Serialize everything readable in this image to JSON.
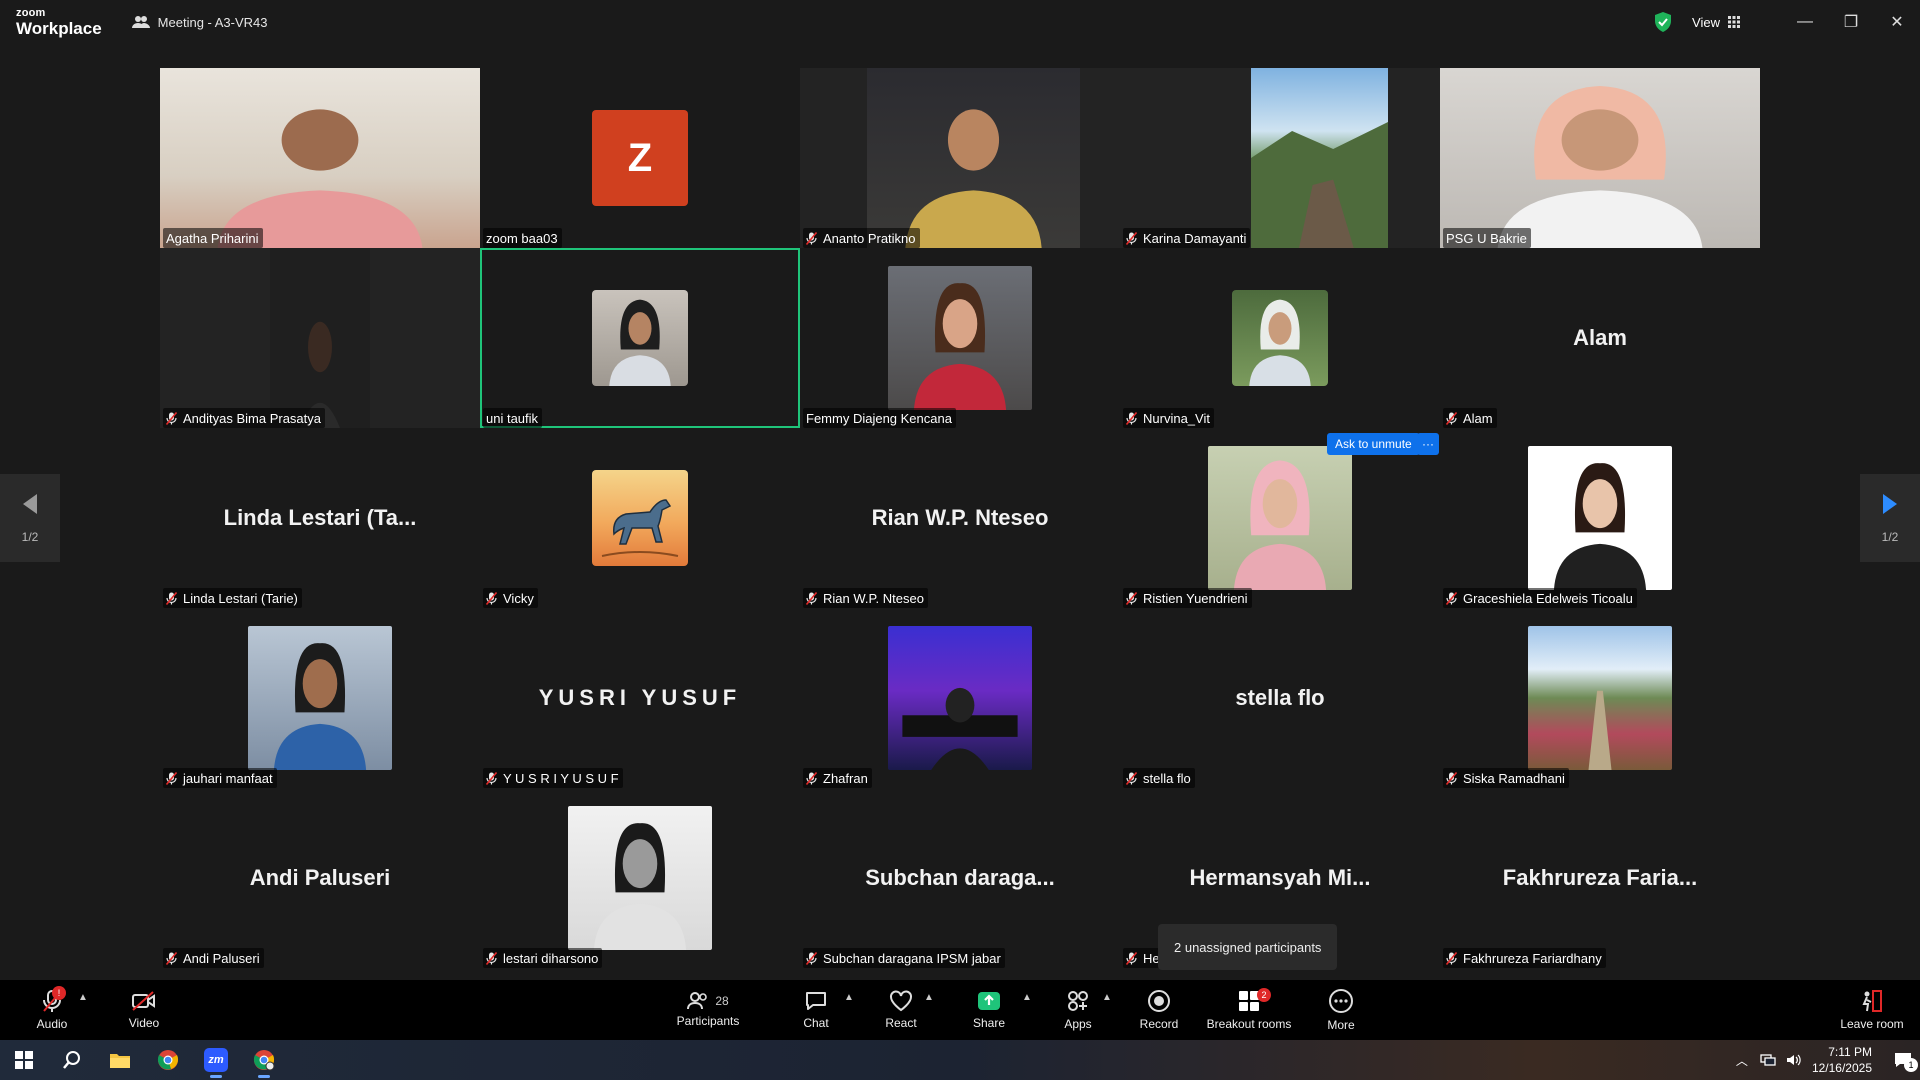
{
  "titlebar": {
    "brand_top": "zoom",
    "brand_bottom": "Workplace",
    "meeting_title": "Meeting - A3-VR43",
    "view_label": "View",
    "colors": {
      "shield": "#1fb35a"
    }
  },
  "participants": [
    {
      "name": "Agatha Priharini",
      "muted": false,
      "display": "photo"
    },
    {
      "name": "zoom baa03",
      "muted": false,
      "display": "initial",
      "initial": "Z"
    },
    {
      "name": "Ananto Pratikno",
      "muted": true,
      "display": "photo"
    },
    {
      "name": "Karina Damayanti",
      "muted": true,
      "display": "photo"
    },
    {
      "name": "PSG U Bakrie",
      "muted": false,
      "display": "photo"
    },
    {
      "name": "Andityas Bima Prasatya",
      "muted": true,
      "display": "photo"
    },
    {
      "name": "uni taufik",
      "muted": false,
      "display": "photo",
      "active_speaker": true
    },
    {
      "name": "Femmy Diajeng Kencana",
      "muted": false,
      "display": "photo"
    },
    {
      "name": "Nurvina_Vit",
      "muted": true,
      "display": "photo"
    },
    {
      "name": "Alam",
      "muted": true,
      "display": "name",
      "tile_text": "Alam"
    },
    {
      "name": "Linda Lestari (Tarie)",
      "muted": true,
      "display": "name",
      "tile_text": "Linda Lestari (Ta..."
    },
    {
      "name": "Vicky",
      "muted": true,
      "display": "photo"
    },
    {
      "name": "Rian W.P. Nteseo",
      "muted": true,
      "display": "name",
      "tile_text": "Rian W.P. Nteseo"
    },
    {
      "name": "Ristien Yuendrieni",
      "muted": true,
      "display": "photo"
    },
    {
      "name": "Graceshiela Edelweis Ticoalu",
      "muted": true,
      "display": "photo"
    },
    {
      "name": "jauhari manfaat",
      "muted": true,
      "display": "photo"
    },
    {
      "name": "Y U S R I  Y U S U F",
      "muted": true,
      "display": "name",
      "tile_text": "YUSRI YUSUF"
    },
    {
      "name": "Zhafran",
      "muted": true,
      "display": "photo"
    },
    {
      "name": "stella flo",
      "muted": true,
      "display": "name",
      "tile_text": "stella flo"
    },
    {
      "name": "Siska Ramadhani",
      "muted": true,
      "display": "photo"
    },
    {
      "name": "Andi Paluseri",
      "muted": true,
      "display": "name",
      "tile_text": "Andi Paluseri"
    },
    {
      "name": "lestari diharsono",
      "muted": true,
      "display": "photo"
    },
    {
      "name": "Subchan daragana IPSM jabar",
      "muted": true,
      "display": "name",
      "tile_text": "Subchan daraga..."
    },
    {
      "name": "He",
      "muted": true,
      "display": "name",
      "tile_text": "Hermansyah Mi..."
    },
    {
      "name": "Fakhrureza Fariardhany",
      "muted": true,
      "display": "name",
      "tile_text": "Fakhrureza Faria..."
    }
  ],
  "ask_to_unmute": {
    "label": "Ask to unmute",
    "more": "···"
  },
  "pager": {
    "prev_page": "1/2",
    "next_page": "1/2"
  },
  "tooltip": "2 unassigned participants",
  "toolbar": {
    "audio": "Audio",
    "video": "Video",
    "participants": "Participants",
    "participants_count": "28",
    "chat": "Chat",
    "react": "React",
    "share": "Share",
    "apps": "Apps",
    "record": "Record",
    "breakout": "Breakout rooms",
    "breakout_badge": "2",
    "more": "More",
    "leave": "Leave room",
    "audio_badge": "!"
  },
  "taskbar": {
    "time": "7:11 PM",
    "date": "12/16/2025",
    "notif_count": "1",
    "zoom_label": "zm"
  }
}
